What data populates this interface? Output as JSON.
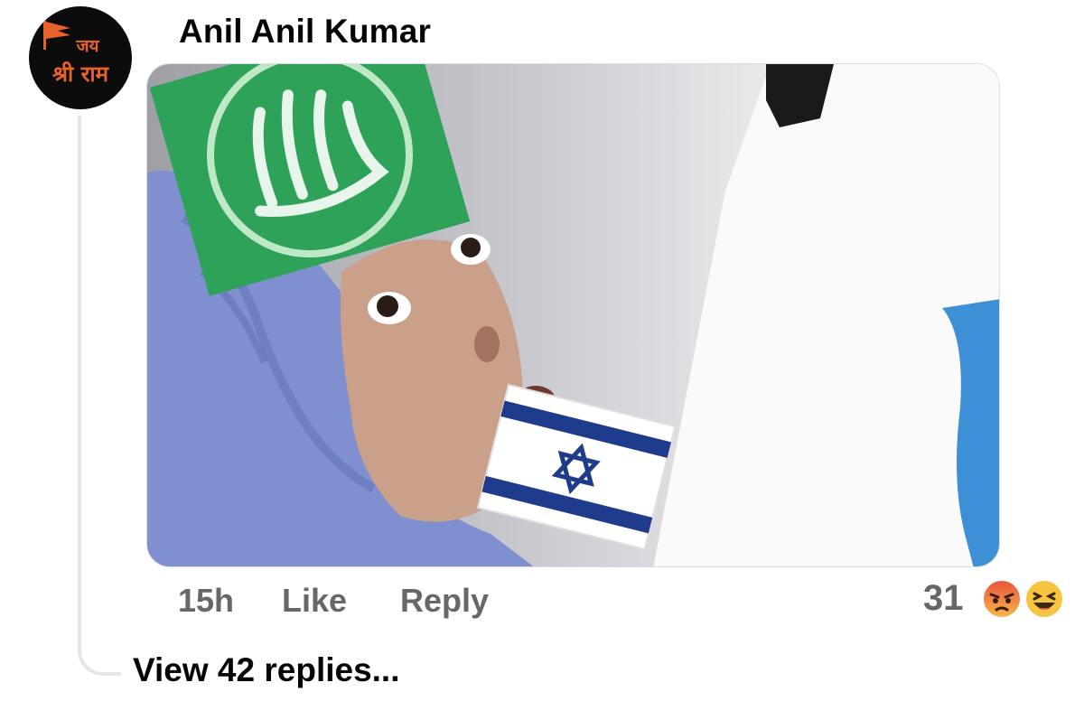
{
  "comment": {
    "avatar": {
      "line1": "जय",
      "line2": "श्री राम",
      "background": "#0c0c0c",
      "text_color": "#e8622b"
    },
    "author_name": "Anil Anil Kumar",
    "timestamp": "15h",
    "like_label": "Like",
    "reply_label": "Reply",
    "reaction_count": "31",
    "reaction_icons": [
      "angry-reaction-icon",
      "haha-reaction-icon"
    ],
    "view_replies_label": "View 42 replies..."
  },
  "colors": {
    "author_text": "#050505",
    "meta_text": "#65676b",
    "thread_line": "#e4e6eb"
  }
}
